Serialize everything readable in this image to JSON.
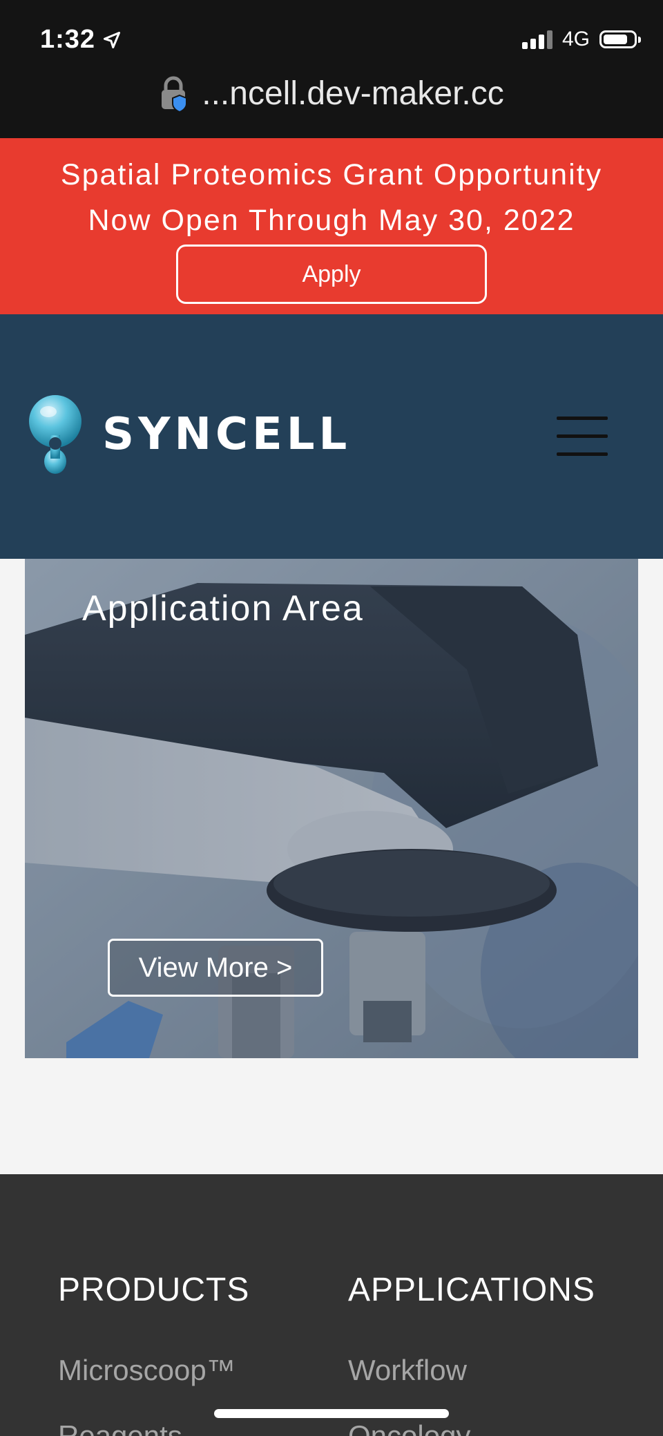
{
  "status_bar": {
    "time": "1:32",
    "network": "4G"
  },
  "url_bar": {
    "url": "...ncell.dev-maker.cc"
  },
  "banner": {
    "line1": "Spatial Proteomics Grant Opportunity",
    "line2": "Now Open Through May 30, 2022",
    "apply_label": "Apply",
    "color": "#e83b2f"
  },
  "header": {
    "logo_text": "SYNCELL",
    "color": "#234058"
  },
  "hero": {
    "title": "Application Area",
    "button_label": "View More >"
  },
  "footer": {
    "columns": [
      {
        "title": "PRODUCTS",
        "links": [
          "Microscoop™",
          "Reagents"
        ]
      },
      {
        "title": "APPLICATIONS",
        "links": [
          "Workflow",
          "Oncology"
        ]
      }
    ],
    "color": "#333333"
  }
}
